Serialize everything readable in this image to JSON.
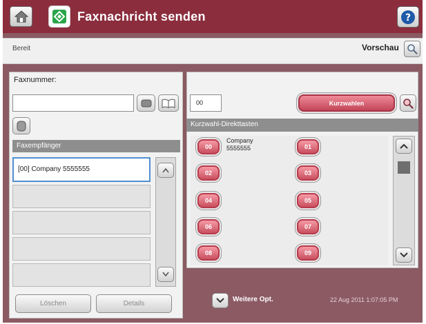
{
  "header": {
    "title": "Faxnachricht senden"
  },
  "status": {
    "text": "Bereit",
    "preview_label": "Vorschau"
  },
  "left_panel": {
    "fax_number_label": "Faxnummer:",
    "fax_number_value": "",
    "recipients_header": "Faxempfänger",
    "recipients": [
      "[00] Company 5555555",
      "",
      "",
      "",
      "",
      ""
    ],
    "delete_label": "Löschen",
    "details_label": "Details"
  },
  "right_panel": {
    "speed_dial_code": "00",
    "speed_dial_button_label": "Kurzwahlen",
    "speed_dial_keys_header": "Kurzwahl-Direkttasten",
    "speed_dial_keys": [
      {
        "code": "00",
        "name": "Company",
        "number": "5555555"
      },
      {
        "code": "01",
        "name": "",
        "number": ""
      },
      {
        "code": "02",
        "name": "",
        "number": ""
      },
      {
        "code": "03",
        "name": "",
        "number": ""
      },
      {
        "code": "04",
        "name": "",
        "number": ""
      },
      {
        "code": "05",
        "name": "",
        "number": ""
      },
      {
        "code": "06",
        "name": "",
        "number": ""
      },
      {
        "code": "07",
        "name": "",
        "number": ""
      },
      {
        "code": "08",
        "name": "",
        "number": ""
      },
      {
        "code": "09",
        "name": "",
        "number": ""
      }
    ]
  },
  "footer": {
    "more_options_label": "Weitere Opt.",
    "datetime": "22 Aug 2011 1:07:05 PM"
  },
  "icons": {
    "home": "home-icon",
    "fax": "fax-send-icon",
    "help": "help-icon",
    "preview": "magnifier-icon",
    "backspace": "backspace-icon",
    "address_book": "address-book-icon",
    "pause": "pause-icon",
    "speed_dial_search": "magnifier-icon",
    "scroll_up": "chevron-up-icon",
    "scroll_down": "chevron-down-icon",
    "more_options": "chevron-down-icon"
  },
  "colors": {
    "header_bg": "#8b2d3d",
    "accent_pink": "#d95b6c",
    "frame_bg": "#8b5a63",
    "fax_icon_green": "#2aa54a"
  }
}
